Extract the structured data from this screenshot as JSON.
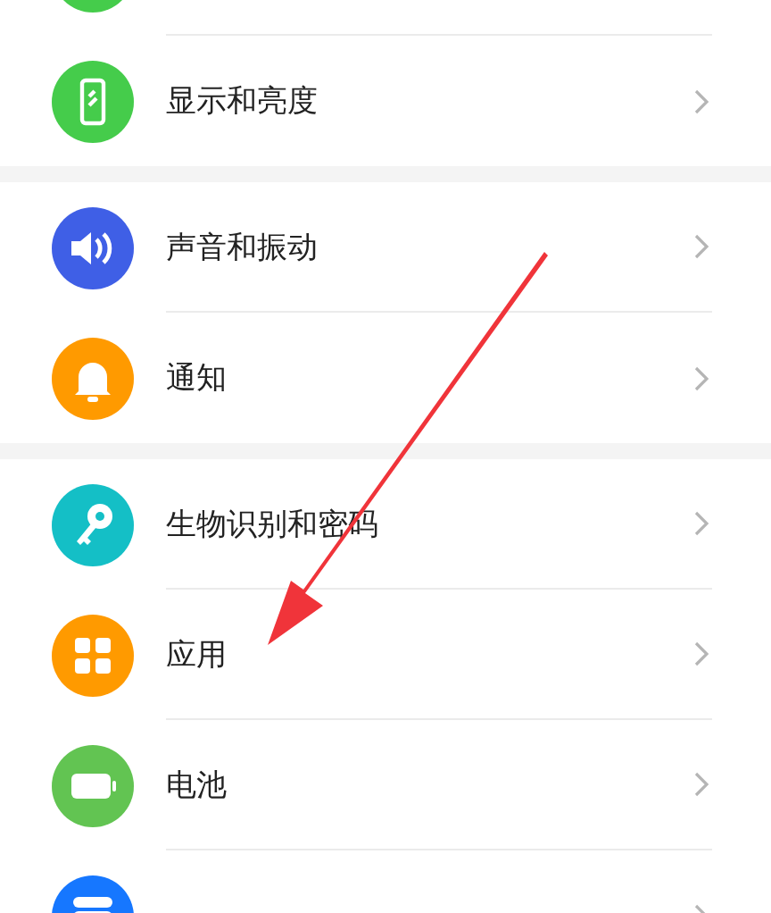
{
  "sections": [
    {
      "items": [
        {
          "kind": "display",
          "color": "#45cc4b",
          "label": "显示和亮度"
        }
      ]
    },
    {
      "items": [
        {
          "kind": "sound",
          "color": "#3f5fe6",
          "label": "声音和振动"
        },
        {
          "kind": "bell",
          "color": "#ff9a00",
          "label": "通知"
        }
      ]
    },
    {
      "items": [
        {
          "kind": "key",
          "color": "#14bfc6",
          "label": "生物识别和密码"
        },
        {
          "kind": "apps",
          "color": "#ff9a00",
          "label": "应用"
        },
        {
          "kind": "battery",
          "color": "#62c452",
          "label": "电池"
        },
        {
          "kind": "storage",
          "color": "#1677ff"
        }
      ]
    }
  ]
}
